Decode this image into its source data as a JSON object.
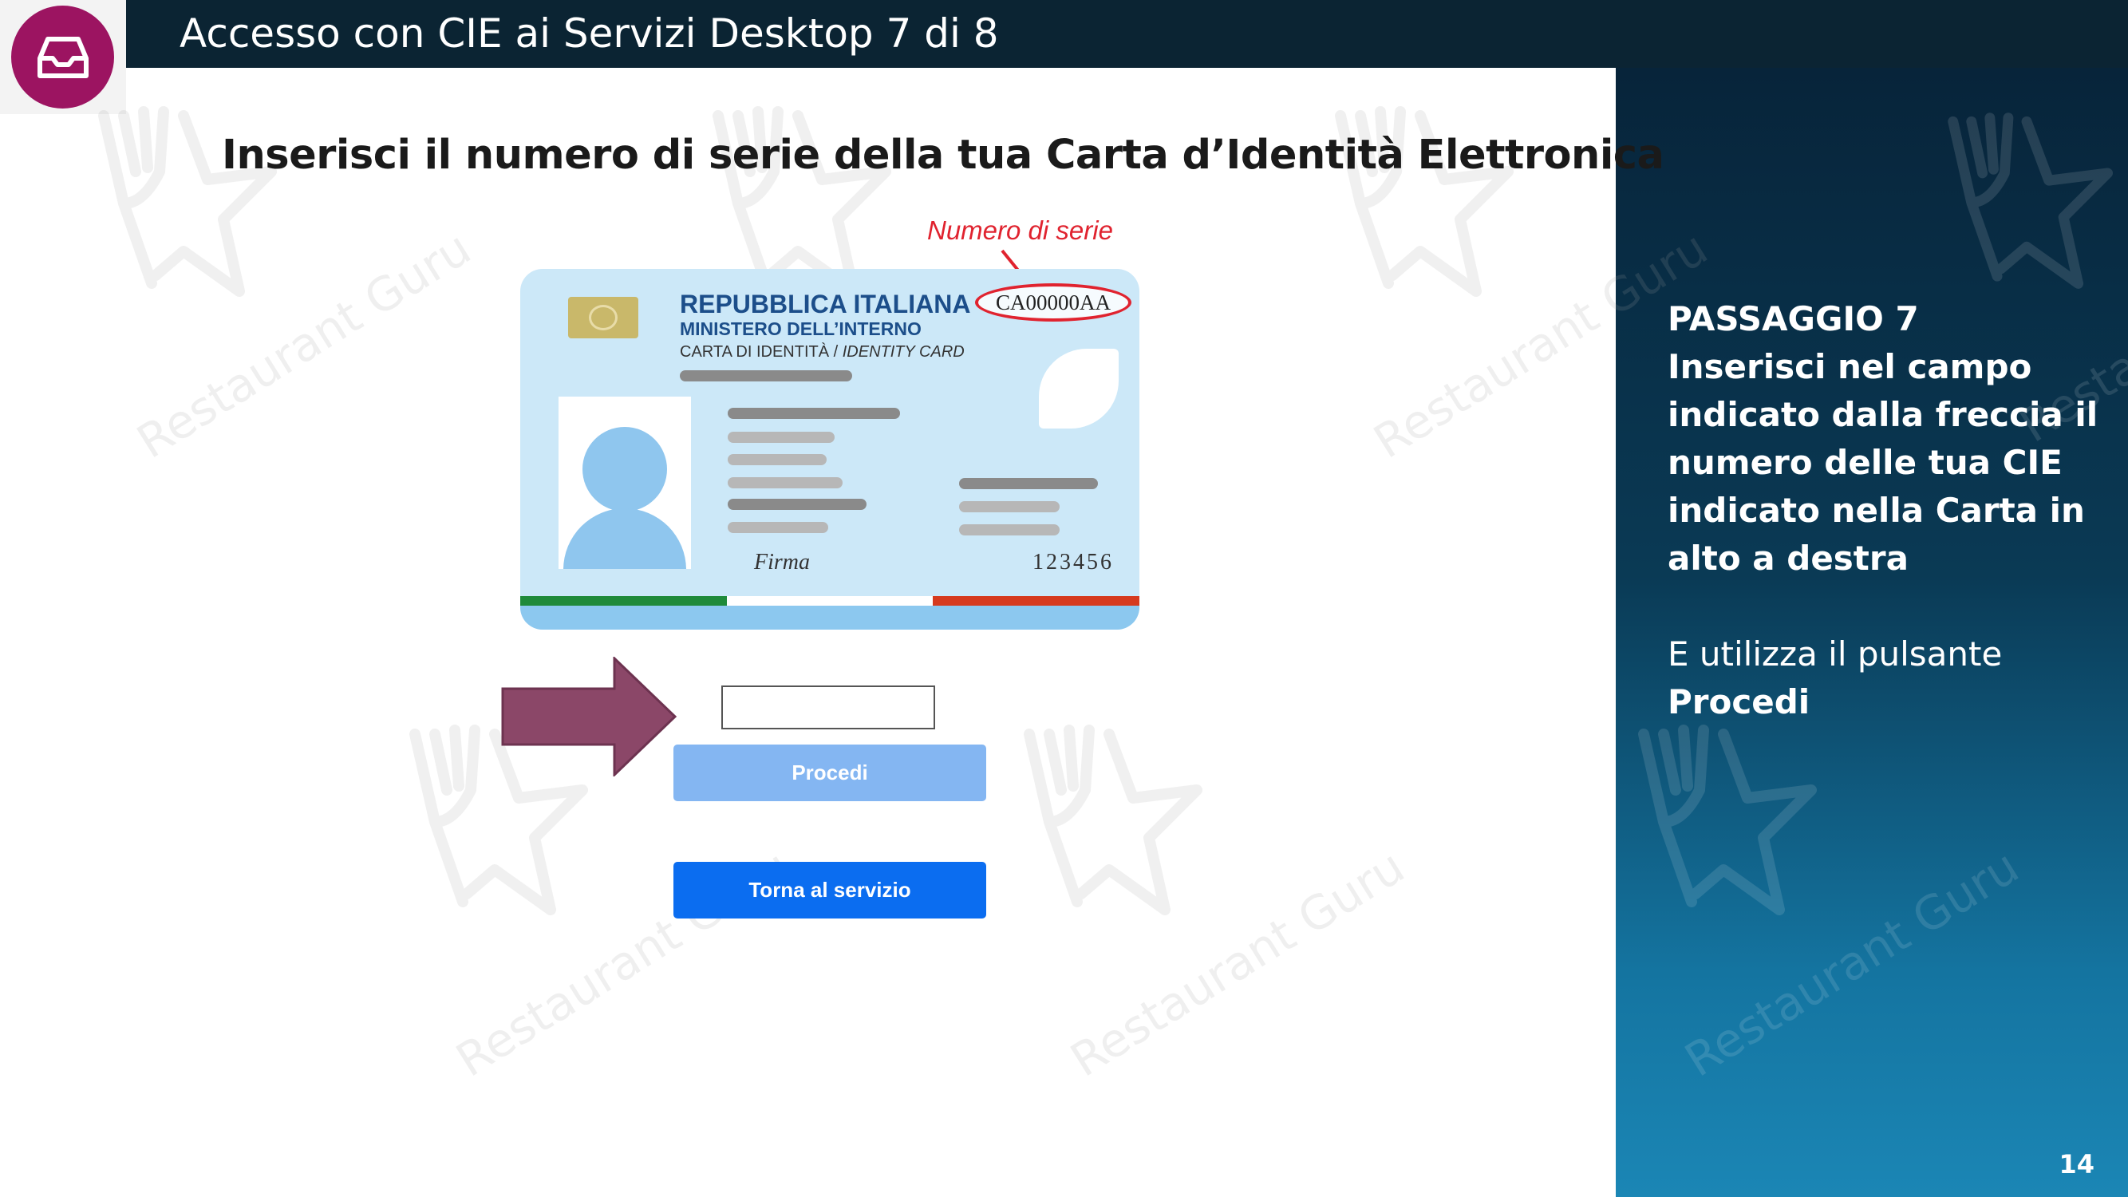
{
  "header": {
    "title": "Accesso con CIE ai Servizi Desktop 7 di 8",
    "logo_icon": "inbox-icon"
  },
  "main": {
    "instruction": "Inserisci il numero di serie della tua Carta d’Identità Elettronica",
    "serial_label": "Numero di serie",
    "card": {
      "republic": "REPUBBLICA ITALIANA",
      "ministry": "MINISTERO DELL’INTERNO",
      "type_it": "CARTA DI IDENTITÀ / ",
      "type_en": "IDENTITY CARD",
      "serial": "CA00000AA",
      "signature": "Firma",
      "number": "123456"
    },
    "input": {
      "value": ""
    },
    "buttons": {
      "procedi": "Procedi",
      "torna": "Torna al servizio"
    }
  },
  "sidebar": {
    "step_title": "PASSAGGIO 7",
    "step_body": "Inserisci nel campo indicato dalla freccia il numero delle tua CIE indicato nella Carta in alto a destra",
    "note_prefix": "E utilizza il pulsante",
    "note_bold": "Procedi"
  },
  "page_number": "14",
  "watermark": "Restaurant Guru",
  "colors": {
    "header_bg": "#0b2433",
    "logo": "#9c1461",
    "arrow": "#8b4768",
    "procedi_button": "#84b6f2",
    "torna_button": "#0b6df0",
    "serial_highlight": "#e0232f"
  }
}
